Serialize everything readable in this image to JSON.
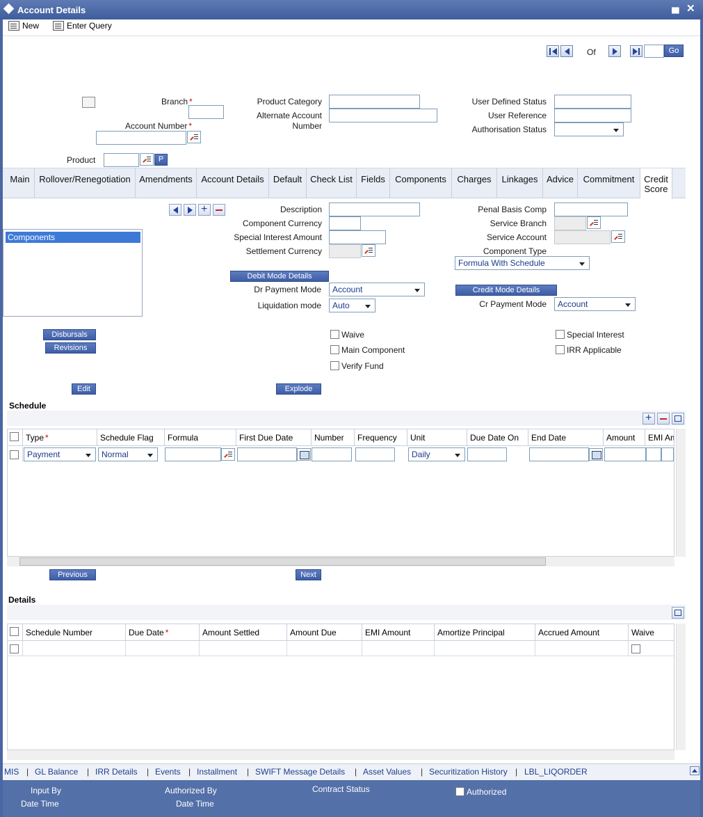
{
  "window": {
    "title": "Account Details"
  },
  "toolbar": {
    "new_label": "New",
    "enter_query_label": "Enter Query"
  },
  "pager": {
    "of_label": "Of",
    "go_label": "Go",
    "current": ""
  },
  "header": {
    "branch_label": "Branch",
    "account_number_label": "Account Number",
    "product_label": "Product",
    "product_p": "P",
    "product_category_label": "Product Category",
    "alternate_account_label_1": "Alternate Account",
    "alternate_account_label_2": "Number",
    "user_defined_status_label": "User Defined Status",
    "user_reference_label": "User Reference",
    "authorisation_status_label": "Authorisation Status"
  },
  "tabs": [
    "Main",
    "Rollover/Renegotiation",
    "Amendments",
    "Account Details",
    "Default",
    "Check List",
    "Fields",
    "Components",
    "Charges",
    "Linkages",
    "Advice",
    "Commitment",
    "Credit",
    "Score"
  ],
  "components": {
    "list_item": "Components",
    "description_label": "Description",
    "component_currency_label": "Component Currency",
    "special_interest_amount_label": "Special Interest Amount",
    "settlement_currency_label": "Settlement Currency",
    "debit_mode_details": "Debit Mode Details",
    "dr_payment_mode_label": "Dr Payment Mode",
    "dr_payment_mode_value": "Account",
    "liquidation_mode_label": "Liquidation mode",
    "liquidation_mode_value": "Auto",
    "penal_basis_comp_label": "Penal Basis Comp",
    "service_branch_label": "Service Branch",
    "service_account_label": "Service Account",
    "component_type_label": "Component Type",
    "component_type_value": "Formula With Schedule",
    "credit_mode_details": "Credit Mode Details",
    "cr_payment_mode_label": "Cr Payment Mode",
    "cr_payment_mode_value": "Account",
    "disbursals": "Disbursals",
    "revisions": "Revisions",
    "edit": "Edit",
    "explode": "Explode",
    "waive": "Waive",
    "main_component": "Main Component",
    "verify_fund": "Verify Fund",
    "special_interest": "Special Interest",
    "irr_applicable": "IRR Applicable"
  },
  "schedule": {
    "title": "Schedule",
    "columns": [
      "Type",
      "Schedule Flag",
      "Formula",
      "First Due Date",
      "Number",
      "Frequency",
      "Unit",
      "Due Date On",
      "End Date",
      "Amount",
      "EMI Am"
    ],
    "row": {
      "type": "Payment",
      "schedule_flag": "Normal",
      "unit": "Daily"
    },
    "previous": "Previous",
    "next": "Next"
  },
  "details": {
    "title": "Details",
    "columns": [
      "Schedule Number",
      "Due Date",
      "Amount Settled",
      "Amount Due",
      "EMI Amount",
      "Amortize Principal",
      "Accrued Amount",
      "Waive"
    ]
  },
  "footer_links": [
    "MIS",
    "GL Balance",
    "IRR Details",
    "Events",
    "Installment",
    "SWIFT Message Details",
    "Asset Values",
    "Securitization History",
    "LBL_LIQORDER"
  ],
  "audit": {
    "input_by": "Input By",
    "date_time_1": "Date Time",
    "authorized_by": "Authorized By",
    "date_time_2": "Date Time",
    "contract_status": "Contract Status",
    "authorized": "Authorized"
  }
}
